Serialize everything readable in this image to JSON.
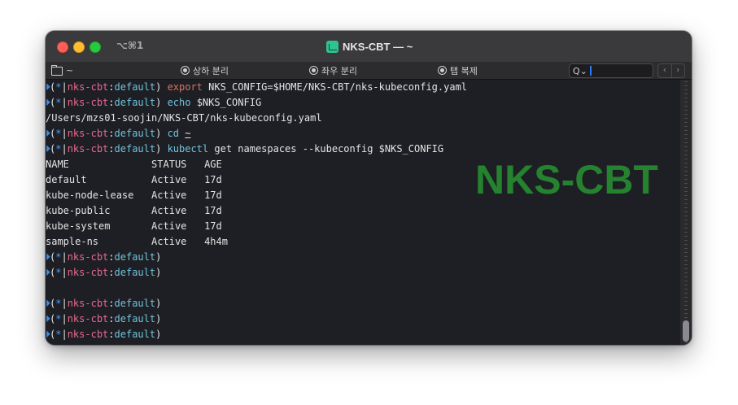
{
  "window": {
    "shortcut": "⌥⌘1",
    "title": "NKS-CBT — ~",
    "app_icon": "terminal-app-icon"
  },
  "toolbar": {
    "dir_label": "~",
    "split_vertical": "상하 분리",
    "split_horizontal": "좌우 분리",
    "duplicate_tab": "탭 복제",
    "search_placeholder": "",
    "search_glyph": "Q⌄",
    "prev": "‹",
    "next": "›"
  },
  "prompt": {
    "star": "*",
    "cluster": "nks-cbt",
    "namespace": "default",
    "open": "(",
    "sep": ":",
    "close": ")"
  },
  "lines": {
    "l1_cmd": "export",
    "l1_rest": " NKS_CONFIG=$HOME/NKS-CBT/nks-kubeconfig.yaml",
    "l2_cmd": "echo",
    "l2_rest": " $NKS_CONFIG",
    "l3_out": "/Users/mzs01-soojin/NKS-CBT/nks-kubeconfig.yaml",
    "l4_cmd": "cd",
    "l4_arg": "~",
    "l5_cmd": "kubectl",
    "l5_rest": " get namespaces --kubeconfig $NKS_CONFIG"
  },
  "table": {
    "header": "NAME              STATUS   AGE",
    "rows": [
      "default           Active   17d",
      "kube-node-lease   Active   17d",
      "kube-public       Active   17d",
      "kube-system       Active   17d",
      "sample-ns         Active   4h4m"
    ]
  },
  "watermark": "NKS-CBT",
  "colors": {
    "cluster": "#e9698f",
    "namespace": "#6fc3dc",
    "command": "#d7745c",
    "watermark": "#25822f"
  }
}
